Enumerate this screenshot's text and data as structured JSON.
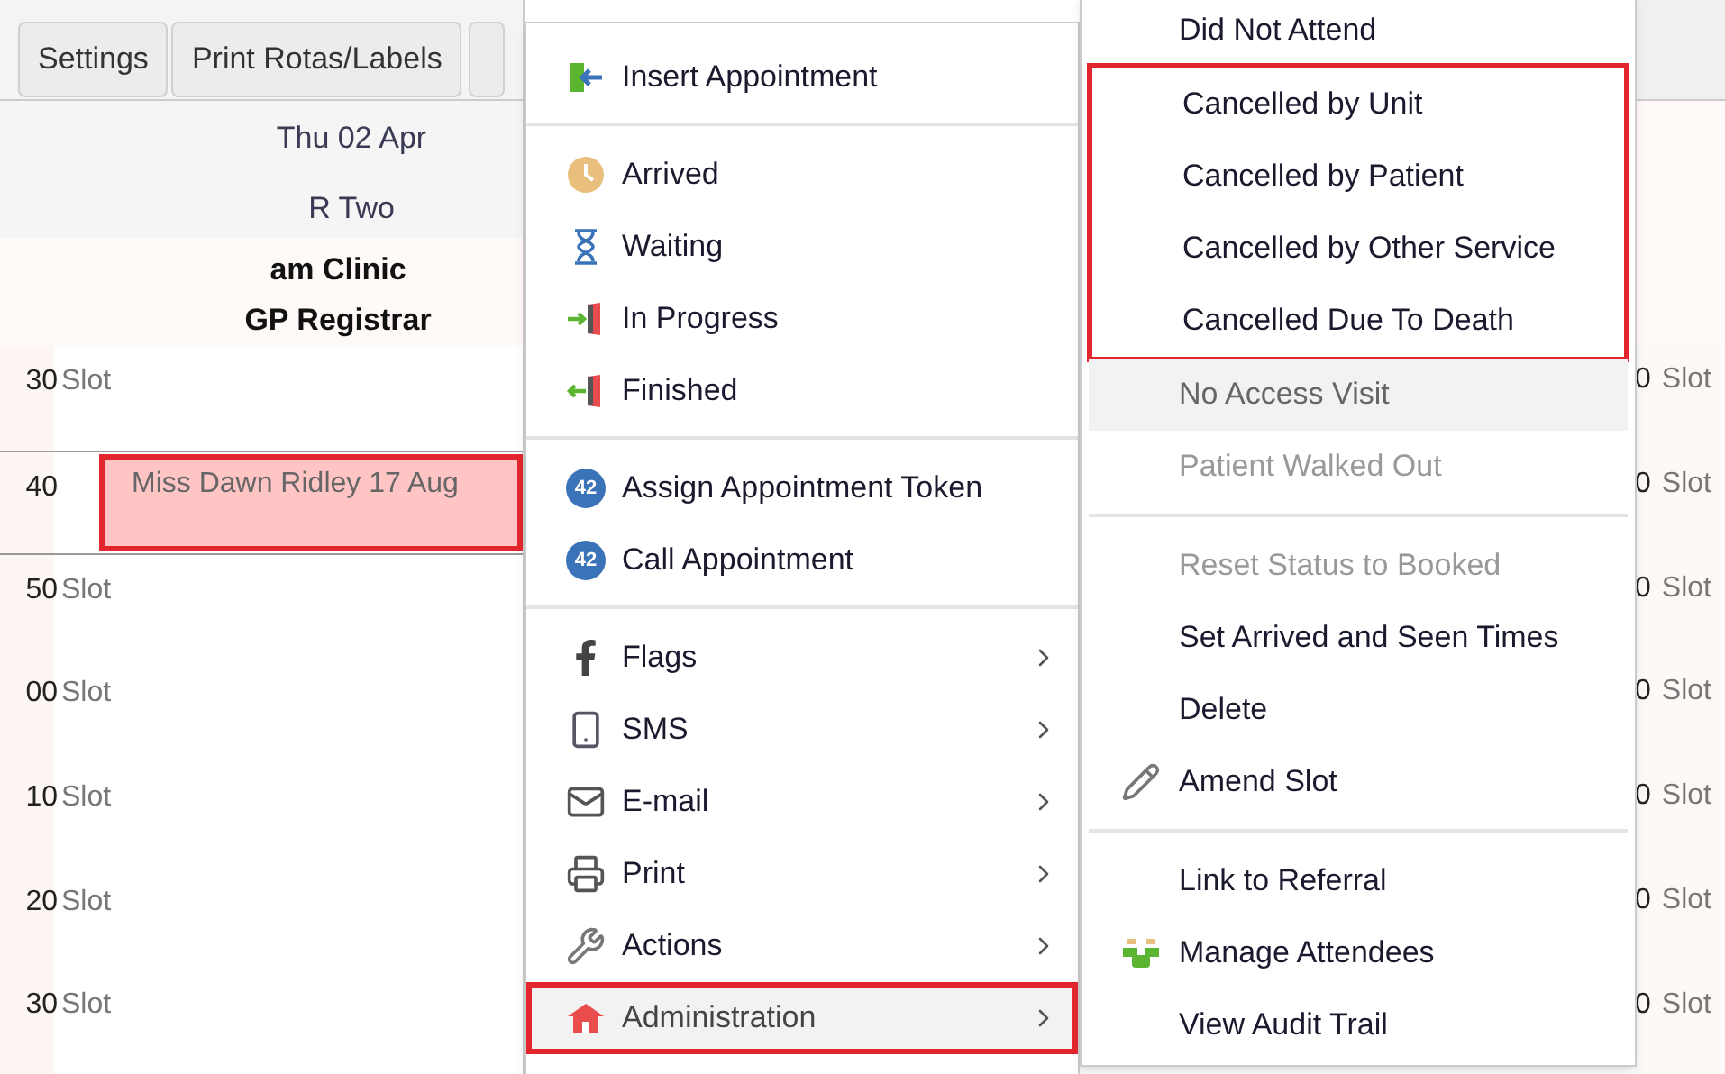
{
  "toolbar": {
    "buttons": [
      "Settings",
      "Print Rotas/Labels"
    ]
  },
  "calendar": {
    "date": "Thu 02 Apr",
    "room": "R Two",
    "session": [
      "am Clinic",
      "GP Registrar"
    ],
    "rows": [
      {
        "time": "30",
        "label": "Slot",
        "kind": "slot",
        "highlighted": false
      },
      {
        "time": "40",
        "label": "Miss Dawn Ridley 17 Aug",
        "kind": "appointment",
        "highlighted": true
      },
      {
        "time": "50",
        "label": "Slot",
        "kind": "slot",
        "highlighted": false
      },
      {
        "time": "00",
        "label": "Slot",
        "kind": "slot",
        "highlighted": false
      },
      {
        "time": "10",
        "label": "Slot",
        "kind": "slot",
        "highlighted": false
      },
      {
        "time": "20",
        "label": "Slot",
        "kind": "slot",
        "highlighted": false
      },
      {
        "time": "30",
        "label": "Slot",
        "kind": "slot",
        "highlighted": false
      }
    ]
  },
  "right_column": {
    "rows": [
      {
        "time": "0",
        "label": "Slot"
      },
      {
        "time": "0",
        "label": "Slot"
      },
      {
        "time": "0",
        "label": "Slot"
      },
      {
        "time": "0",
        "label": "Slot"
      },
      {
        "time": "0",
        "label": "Slot"
      },
      {
        "time": "0",
        "label": "Slot"
      },
      {
        "time": "0",
        "label": "Slot"
      }
    ]
  },
  "context_menu": {
    "sections": [
      {
        "items": [
          {
            "label": "Insert Appointment",
            "has_submenu": false,
            "active": false,
            "highlighted": false
          }
        ]
      },
      {
        "items": [
          {
            "label": "Arrived",
            "has_submenu": false,
            "active": false,
            "highlighted": false
          },
          {
            "label": "Waiting",
            "has_submenu": false,
            "active": false,
            "highlighted": false
          },
          {
            "label": "In Progress",
            "has_submenu": false,
            "active": false,
            "highlighted": false
          },
          {
            "label": "Finished",
            "has_submenu": false,
            "active": false,
            "highlighted": false
          }
        ]
      },
      {
        "items": [
          {
            "label": "Assign Appointment Token",
            "badge": "42",
            "has_submenu": false,
            "active": false,
            "highlighted": false
          },
          {
            "label": "Call Appointment",
            "badge": "42",
            "has_submenu": false,
            "active": false,
            "highlighted": false
          }
        ]
      },
      {
        "items": [
          {
            "label": "Flags",
            "has_submenu": true,
            "active": false,
            "highlighted": false
          },
          {
            "label": "SMS",
            "has_submenu": true,
            "active": false,
            "highlighted": false
          },
          {
            "label": "E-mail",
            "has_submenu": true,
            "active": false,
            "highlighted": false
          },
          {
            "label": "Print",
            "has_submenu": true,
            "active": false,
            "highlighted": false
          },
          {
            "label": "Actions",
            "has_submenu": true,
            "active": false,
            "highlighted": false
          },
          {
            "label": "Administration",
            "has_submenu": true,
            "active": true,
            "highlighted": true
          }
        ]
      }
    ]
  },
  "submenu": {
    "sections": [
      {
        "items": [
          {
            "label": "Did Not Attend",
            "disabled": false,
            "active": false,
            "highlighted": false
          },
          {
            "label": "Cancelled by Unit",
            "disabled": false,
            "active": false,
            "highlighted": true
          },
          {
            "label": "Cancelled by Patient",
            "disabled": false,
            "active": false,
            "highlighted": true
          },
          {
            "label": "Cancelled by Other Service",
            "disabled": false,
            "active": false,
            "highlighted": true
          },
          {
            "label": "Cancelled Due To Death",
            "disabled": false,
            "active": false,
            "highlighted": true
          },
          {
            "label": "No Access Visit",
            "disabled": true,
            "active": true,
            "highlighted": false
          },
          {
            "label": "Patient Walked Out",
            "disabled": true,
            "active": false,
            "highlighted": false
          }
        ]
      },
      {
        "items": [
          {
            "label": "Reset Status to Booked",
            "disabled": true,
            "active": false,
            "highlighted": false
          },
          {
            "label": "Set Arrived and Seen Times",
            "disabled": false,
            "active": false,
            "highlighted": false
          },
          {
            "label": "Delete",
            "disabled": false,
            "active": false,
            "highlighted": false
          },
          {
            "label": "Amend Slot",
            "disabled": false,
            "active": false,
            "highlighted": false
          }
        ]
      },
      {
        "items": [
          {
            "label": "Link to Referral",
            "disabled": false,
            "active": false,
            "highlighted": false
          },
          {
            "label": "Manage Attendees",
            "disabled": false,
            "active": false,
            "highlighted": false
          },
          {
            "label": "View Audit Trail",
            "disabled": false,
            "active": false,
            "highlighted": false
          }
        ]
      }
    ]
  }
}
